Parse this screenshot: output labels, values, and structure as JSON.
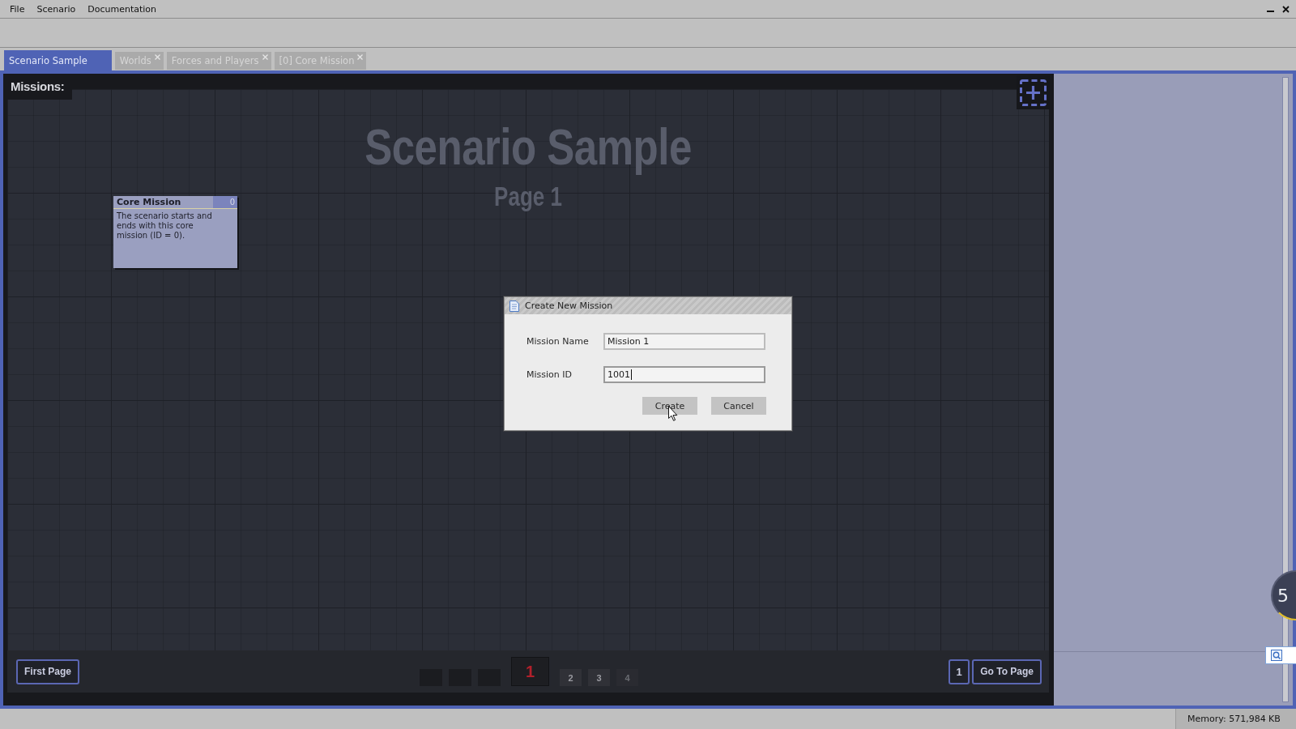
{
  "menu_bar": {
    "items": [
      "File",
      "Scenario",
      "Documentation"
    ]
  },
  "tabs": [
    {
      "label": "Scenario Sample",
      "selected": true,
      "closable": false
    },
    {
      "label": "Worlds",
      "selected": false,
      "closable": true
    },
    {
      "label": "Forces and Players",
      "selected": false,
      "closable": true
    },
    {
      "label": "[0] Core Mission",
      "selected": false,
      "closable": true
    }
  ],
  "canvas": {
    "header": "Missions:",
    "title": "Scenario Sample",
    "subtitle": "Page 1",
    "missions": [
      {
        "title": "Core Mission",
        "id": "0",
        "description": "The scenario starts and ends with this core mission (ID = 0)."
      }
    ]
  },
  "dialog": {
    "title": "Create New Mission",
    "fields": [
      {
        "label": "Mission Name",
        "value": "Mission 1",
        "focused": false
      },
      {
        "label": "Mission ID",
        "value": "1001",
        "focused": true
      }
    ],
    "buttons": [
      "Create",
      "Cancel"
    ]
  },
  "pagination": {
    "first_button": "First Page",
    "pages": [
      {
        "kind": "blank"
      },
      {
        "kind": "blank"
      },
      {
        "kind": "blank"
      },
      {
        "kind": "page",
        "label": "1",
        "selected": true,
        "disabled": false
      },
      {
        "kind": "page",
        "label": "2",
        "selected": false,
        "disabled": false
      },
      {
        "kind": "page",
        "label": "3",
        "selected": false,
        "disabled": false
      },
      {
        "kind": "page",
        "label": "4",
        "selected": false,
        "disabled": true
      }
    ],
    "page_input": "1",
    "go_button": "Go To Page"
  },
  "floating_widget": {
    "reading": "5"
  },
  "status_bar": {
    "memory": "Memory: 571,984 KB"
  }
}
